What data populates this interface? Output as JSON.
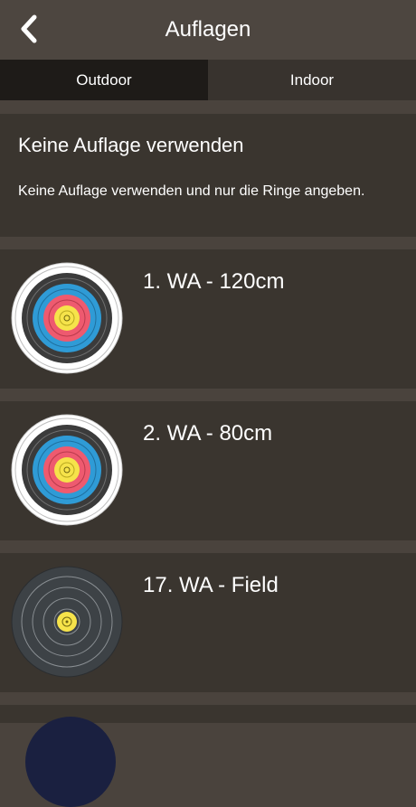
{
  "header": {
    "title": "Auflagen"
  },
  "tabs": [
    {
      "label": "Outdoor",
      "active": true
    },
    {
      "label": "Indoor",
      "active": false
    }
  ],
  "no_target": {
    "title": "Keine Auflage verwenden",
    "description": "Keine Auflage verwenden und nur die Ringe angeben."
  },
  "targets": [
    {
      "label": "1. WA - 120cm",
      "icon": "wa-full-target-icon"
    },
    {
      "label": "2. WA - 80cm",
      "icon": "wa-full-target-icon"
    },
    {
      "label": "17. WA - Field",
      "icon": "wa-field-target-icon"
    }
  ],
  "colors": {
    "background": "#4a433d",
    "card": "#3a352f",
    "tab_active": "#1e1b18",
    "tab_inactive": "#38332e"
  }
}
